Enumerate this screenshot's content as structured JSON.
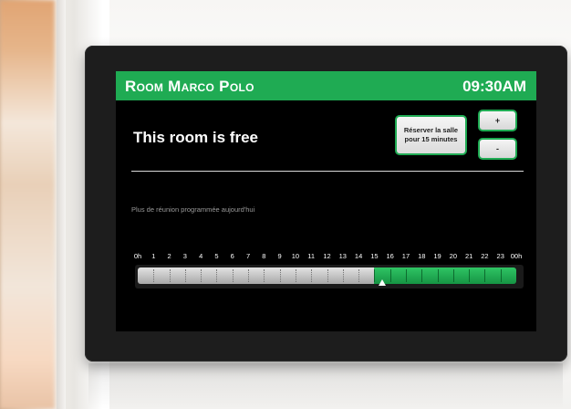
{
  "screen": {
    "header": {
      "room_name": "Room Marco Polo",
      "time": "09:30AM",
      "color": "#1fab53"
    },
    "status_text": "This room is free",
    "reserve_button": "Réserver la salle pour 15 minutes",
    "plus_button": "+",
    "minus_button": "-",
    "message": "Plus de réunion programmée aujourd'hui",
    "timeline": {
      "hour_labels": [
        "0h",
        "1",
        "2",
        "3",
        "4",
        "5",
        "6",
        "7",
        "8",
        "9",
        "10",
        "11",
        "12",
        "13",
        "14",
        "15",
        "16",
        "17",
        "18",
        "19",
        "20",
        "21",
        "22",
        "23",
        "00h"
      ],
      "past_hours": 15,
      "total_hours": 24,
      "current_hour_fraction": 15.5,
      "past_color": "#b9b9b9",
      "free_color": "#1fab53"
    }
  }
}
